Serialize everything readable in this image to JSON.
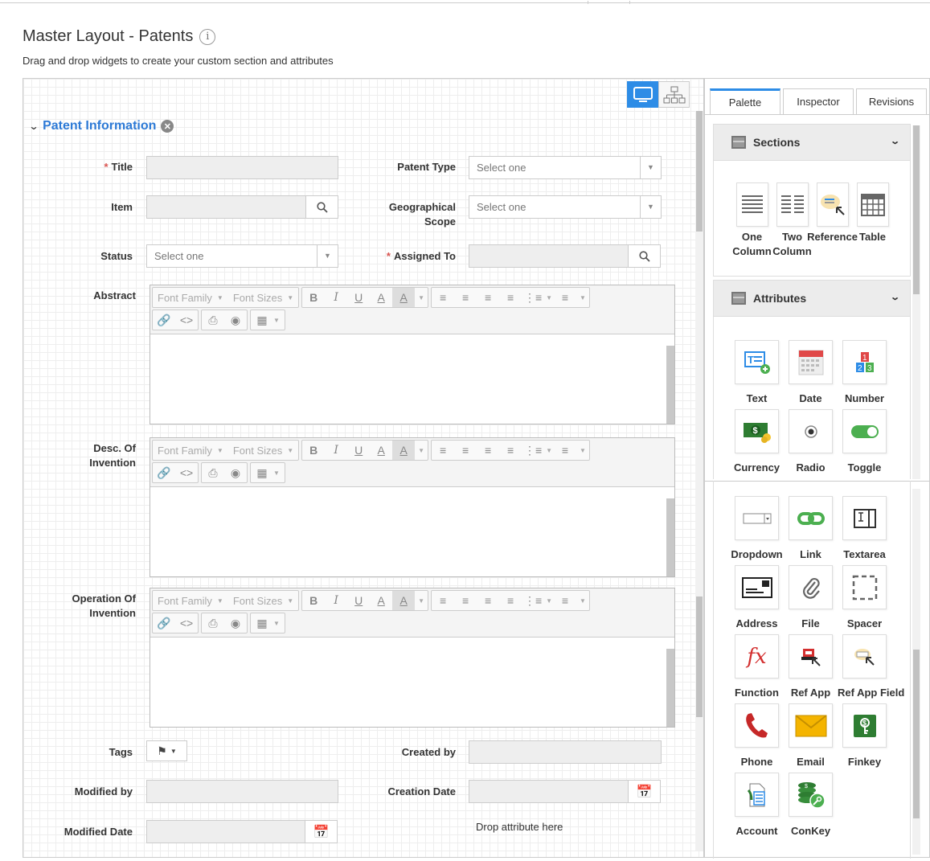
{
  "header": {
    "title": "Master Layout - Patents",
    "subtitle": "Drag and drop widgets to create your custom section and attributes"
  },
  "view_toggle": {
    "active": "desktop"
  },
  "section": {
    "title": "Patent Information"
  },
  "fields": {
    "title": {
      "label": "Title",
      "required": "*"
    },
    "patent_type": {
      "label": "Patent Type",
      "placeholder": "Select one"
    },
    "item": {
      "label": "Item"
    },
    "geo_scope": {
      "label_line1": "Geographical",
      "label_line2": "Scope",
      "placeholder": "Select one"
    },
    "status": {
      "label": "Status",
      "placeholder": "Select one"
    },
    "assigned_to": {
      "label": "Assigned To",
      "required": "*"
    },
    "abstract": {
      "label": "Abstract"
    },
    "desc_invention": {
      "label_line1": "Desc. Of",
      "label_line2": "Invention"
    },
    "operation_invention": {
      "label_line1": "Operation Of",
      "label_line2": "Invention"
    },
    "tags": {
      "label": "Tags"
    },
    "created_by": {
      "label": "Created by"
    },
    "modified_by": {
      "label": "Modified by"
    },
    "creation_date": {
      "label": "Creation Date"
    },
    "modified_date": {
      "label": "Modified Date"
    },
    "drop_hint": "Drop attribute here"
  },
  "editor_toolbar": {
    "font_family": "Font Family",
    "font_sizes": "Font Sizes",
    "bold": "B",
    "italic": "I",
    "underline": "U",
    "color": "A",
    "bg_color": "A"
  },
  "panel": {
    "tabs": [
      "Palette",
      "Inspector",
      "Revisions"
    ],
    "sections_title": "Sections",
    "attributes_title": "Attributes",
    "section_widgets": [
      {
        "line1": "One",
        "line2": "Column"
      },
      {
        "line1": "Two",
        "line2": "Column"
      },
      {
        "line1": "Reference",
        "line2": ""
      },
      {
        "line1": "Table",
        "line2": ""
      }
    ],
    "attribute_widgets": [
      "Text",
      "Date",
      "Number",
      "Currency",
      "Radio",
      "Toggle"
    ],
    "more_widgets": [
      "Dropdown",
      "Link",
      "Textarea",
      "Address",
      "File",
      "Spacer",
      "Function",
      "Ref App",
      "Ref App Field",
      "Phone",
      "Email",
      "Finkey",
      "Account",
      "ConKey"
    ]
  },
  "colors": {
    "accent": "#2d8ce6",
    "section_title": "#2d7ad6",
    "required": "#d9534f"
  }
}
